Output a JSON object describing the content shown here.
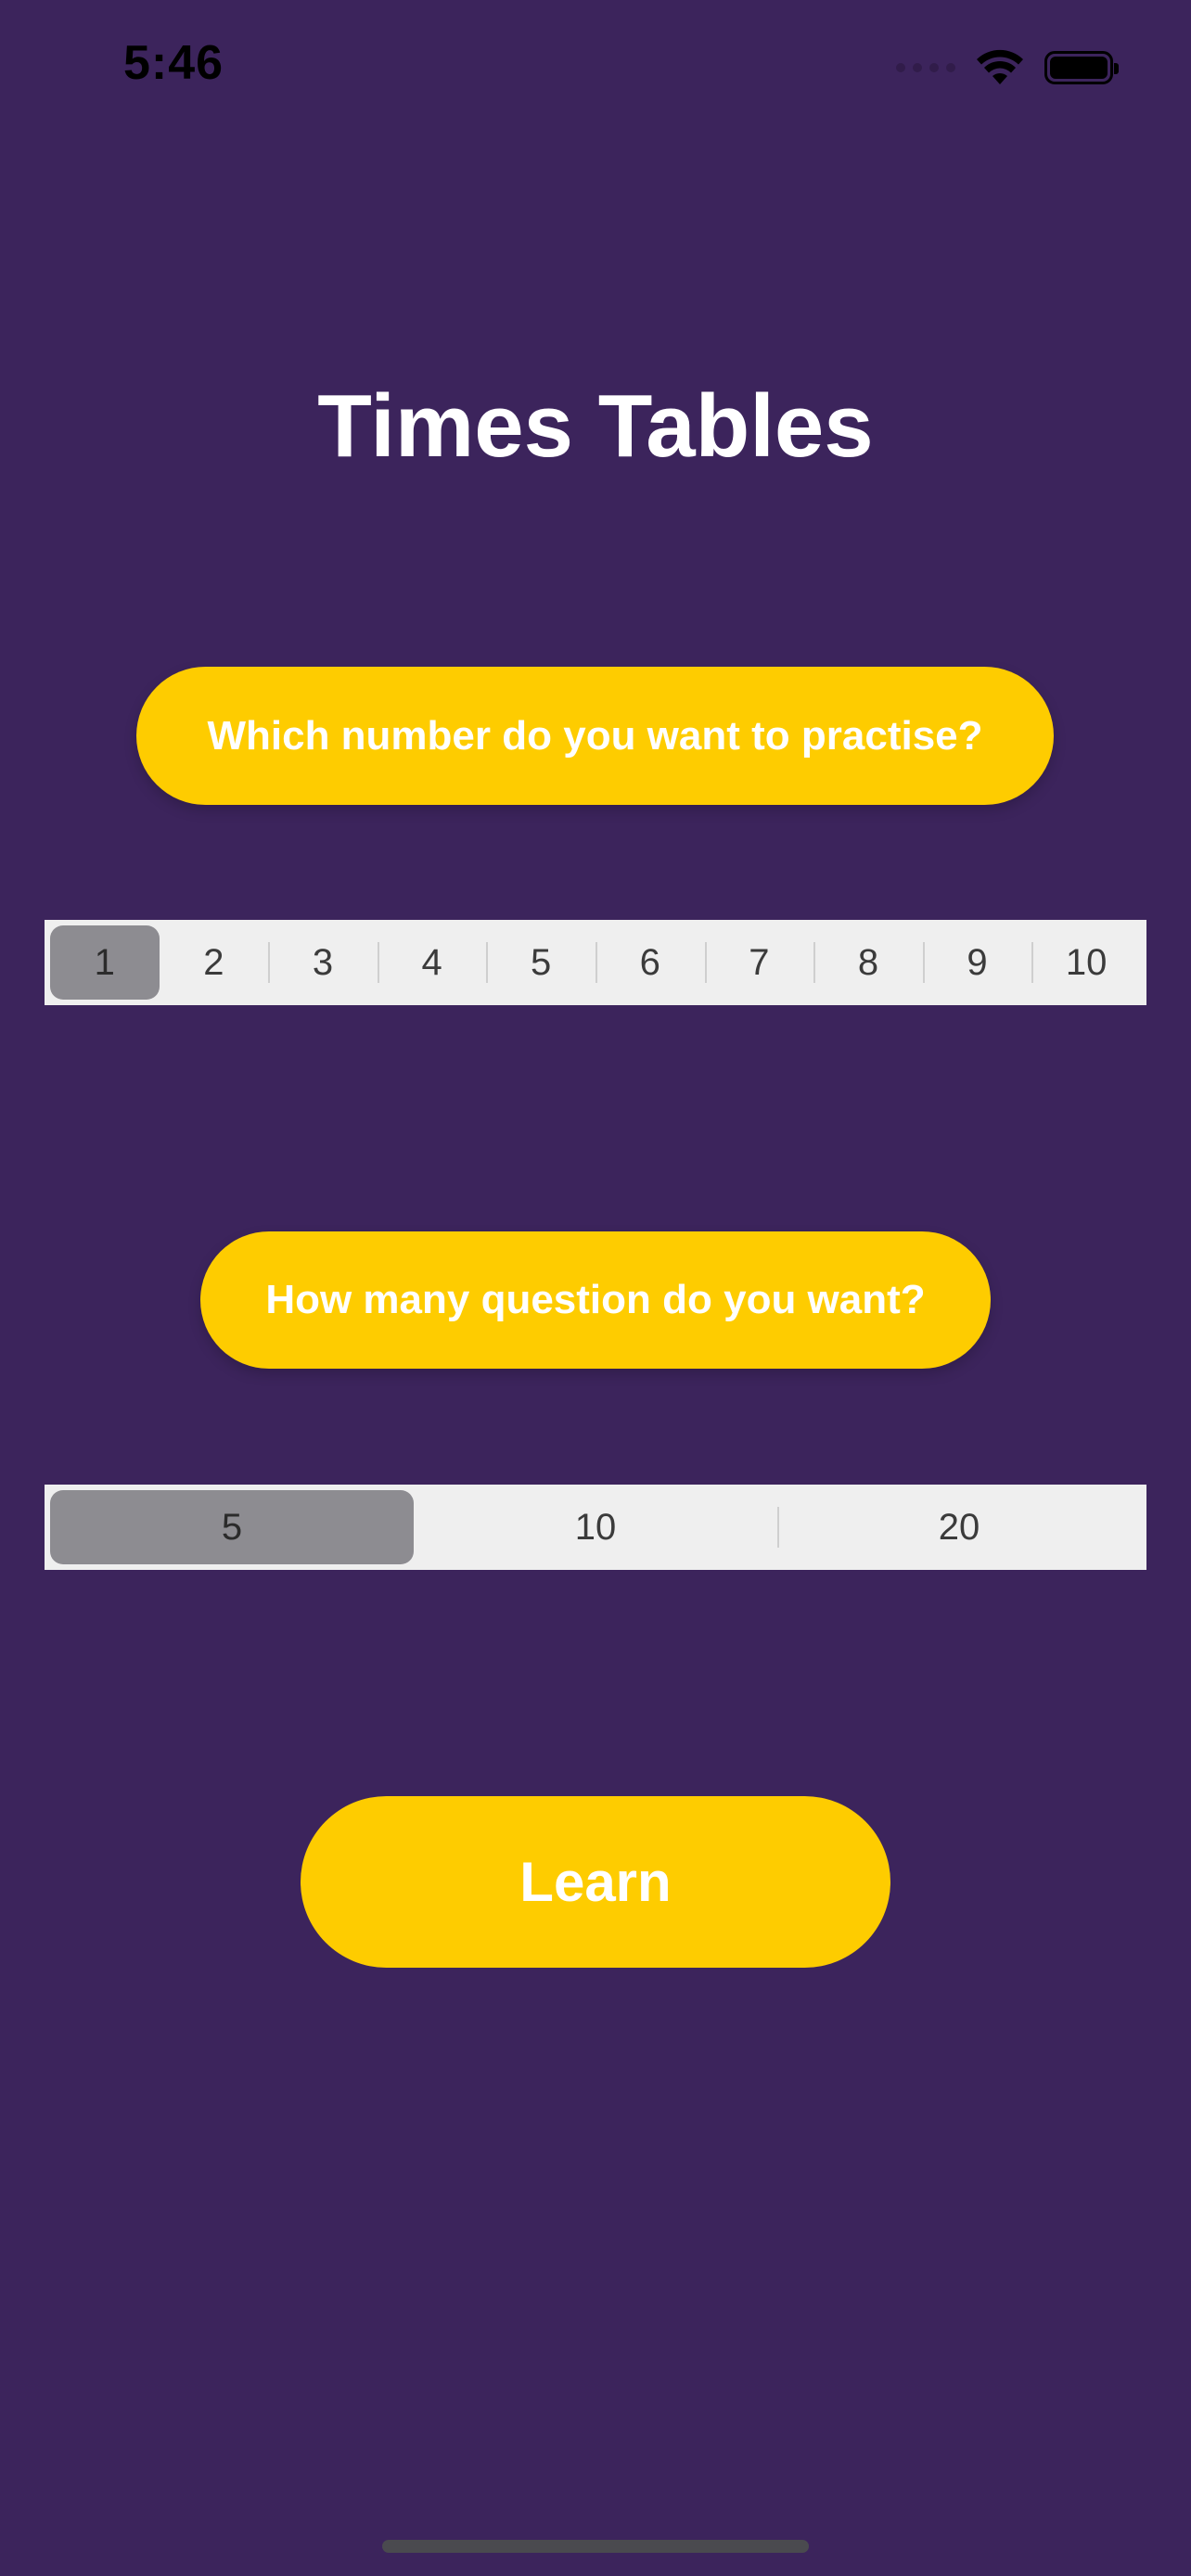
{
  "status_bar": {
    "time": "5:46"
  },
  "title": "Times Tables",
  "number_prompt": "Which number do you want to practise?",
  "number_options": [
    "1",
    "2",
    "3",
    "4",
    "5",
    "6",
    "7",
    "8",
    "9",
    "10"
  ],
  "number_selected": "1",
  "question_prompt": "How many question do you want?",
  "question_options": [
    "5",
    "10",
    "20"
  ],
  "question_selected": "5",
  "learn_button_label": "Learn",
  "colors": {
    "background": "#3c245c",
    "accent": "#fecc00",
    "segment_background": "#efefef",
    "segment_selected": "#8d8c91"
  },
  "icons": [
    "cellular-signal-icon",
    "wifi-icon",
    "battery-icon"
  ]
}
